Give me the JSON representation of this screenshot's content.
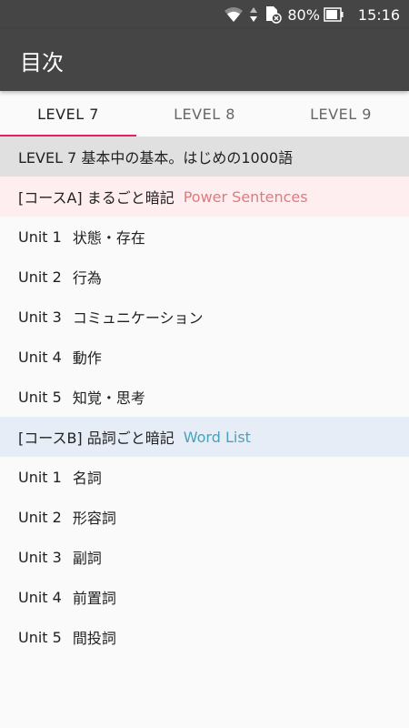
{
  "statusbar": {
    "battery": "80%",
    "time": "15:16"
  },
  "appbar": {
    "title": "目次"
  },
  "tabs": [
    {
      "label": "LEVEL 7"
    },
    {
      "label": "LEVEL 8"
    },
    {
      "label": "LEVEL 9"
    }
  ],
  "level_header": "LEVEL 7 基本中の基本。はじめの1000語",
  "course_a": {
    "label": "[コースA] まるごと暗記",
    "sub": "Power Sentences",
    "units": [
      {
        "no": "Unit 1",
        "title": "状態・存在"
      },
      {
        "no": "Unit 2",
        "title": "行為"
      },
      {
        "no": "Unit 3",
        "title": "コミュニケーション"
      },
      {
        "no": "Unit 4",
        "title": "動作"
      },
      {
        "no": "Unit 5",
        "title": "知覚・思考"
      }
    ]
  },
  "course_b": {
    "label": "[コースB] 品詞ごと暗記",
    "sub": "Word List",
    "units": [
      {
        "no": "Unit 1",
        "title": "名詞"
      },
      {
        "no": "Unit 2",
        "title": "形容詞"
      },
      {
        "no": "Unit 3",
        "title": "副詞"
      },
      {
        "no": "Unit 4",
        "title": "前置詞"
      },
      {
        "no": "Unit 5",
        "title": "間投詞"
      }
    ]
  },
  "colors": {
    "appbar": "#454545",
    "tab_indicator": "#e91e63",
    "course_a_bg": "#ffeef0",
    "course_a_sub": "#e07a7e",
    "course_b_bg": "#e6edf7",
    "course_b_sub": "#4aa3b5"
  }
}
